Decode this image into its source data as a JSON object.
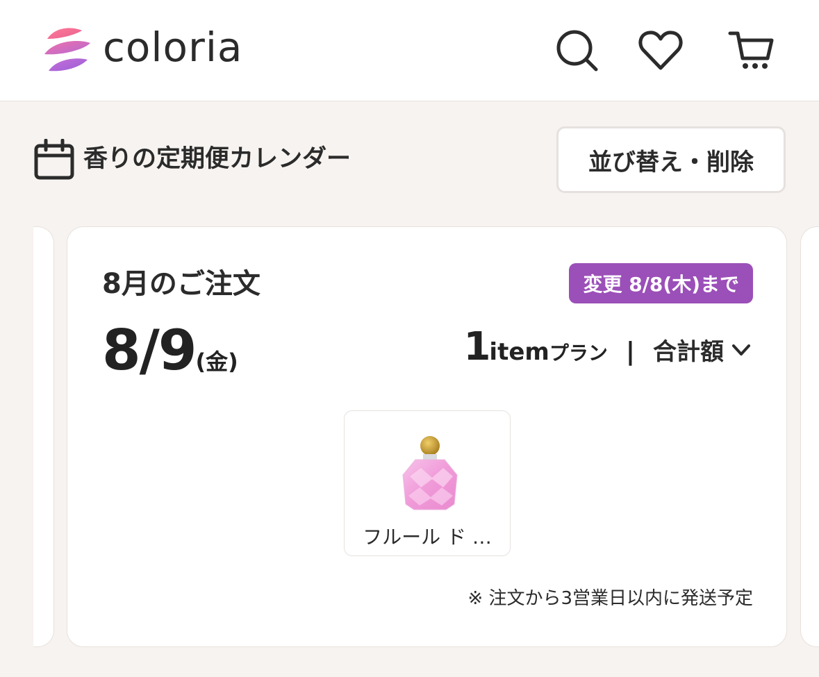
{
  "header": {
    "logo_text": "coloria",
    "icons": [
      "search-icon",
      "heart-icon",
      "cart-icon"
    ]
  },
  "section": {
    "icon": "calendar-icon",
    "title": "香りの定期便カレンダー",
    "sort_button": "並び替え・削除"
  },
  "order": {
    "month_title": "8月のご注文",
    "deadline_badge": "変更 8/8(木)まで",
    "date": "8/9",
    "day_of_week": "(金)",
    "plan_count": "1",
    "plan_item": "item",
    "plan_label": "プラン",
    "separator": "|",
    "total_label": "合計額",
    "product": {
      "name": "フルール ド …",
      "image_icon": "perfume-bottle-icon"
    },
    "shipping_note": "※ 注文から3営業日以内に発送予定"
  },
  "colors": {
    "accent_purple": "#9b4fb8",
    "background": "#f7f3f0",
    "card": "#ffffff"
  }
}
